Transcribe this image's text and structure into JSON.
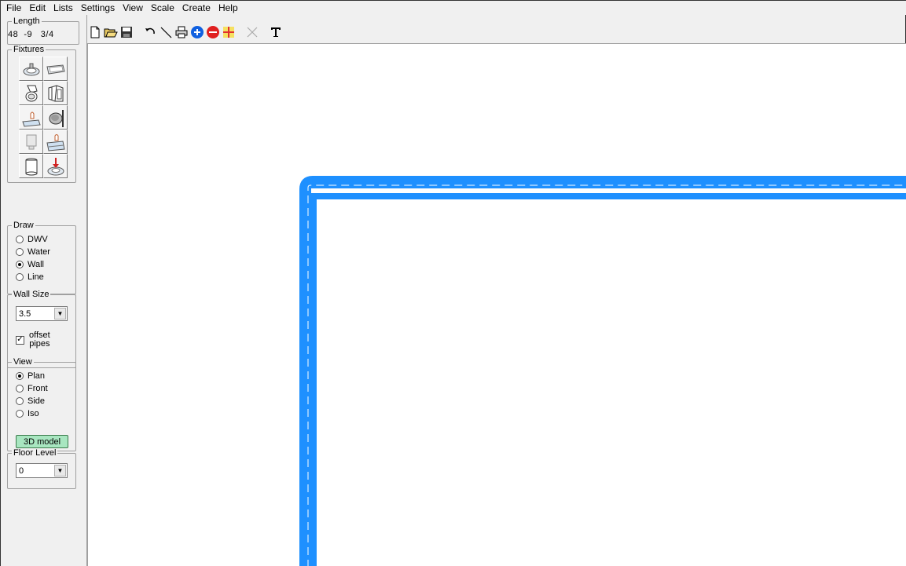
{
  "menubar": {
    "items": [
      "File",
      "Edit",
      "Lists",
      "Settings",
      "View",
      "Scale",
      "Create",
      "Help"
    ]
  },
  "toolbar": {
    "buttons": [
      "new-file",
      "open-folder",
      "save",
      "undo",
      "draw-line",
      "print",
      "zoom-in",
      "zoom-out",
      "grid",
      "delete",
      "text"
    ]
  },
  "sidebar": {
    "length": {
      "title": "Length",
      "value": "48  -9   3/4"
    },
    "fixtures": {
      "title": "Fixtures",
      "items": [
        "sink",
        "bathtub",
        "toilet",
        "shower",
        "lavatory",
        "floor-drain",
        "urinal",
        "laundry-sink",
        "water-heater",
        "drain"
      ]
    },
    "draw": {
      "title": "Draw",
      "options": [
        "DWV",
        "Water",
        "Wall",
        "Line"
      ],
      "selected": "Wall"
    },
    "wall_size": {
      "title": "Wall Size",
      "value": "3.5",
      "offset_label_1": "offset",
      "offset_label_2": "pipes",
      "offset_checked": true
    },
    "view": {
      "title": "View",
      "options": [
        "Plan",
        "Front",
        "Side",
        "Iso"
      ],
      "selected": "Plan",
      "model_button": "3D model"
    },
    "floor": {
      "title": "Floor Level",
      "value": "0"
    }
  },
  "colors": {
    "wall": "#1e90ff",
    "model_button": "#a8e6c0"
  }
}
